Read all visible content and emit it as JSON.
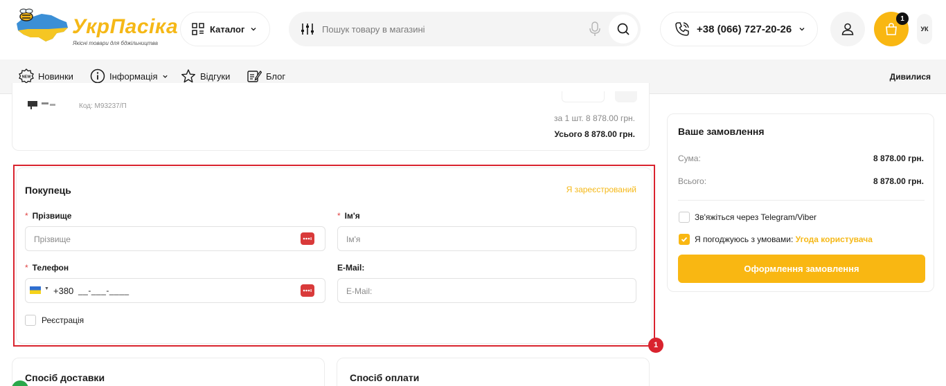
{
  "header": {
    "logo_text": "УкрПасіка",
    "logo_sub": "Якісні товари для бджільництва",
    "catalog_label": "Каталог",
    "search_placeholder": "Пошук товару в магазині",
    "phone": "+38 (066) 727-20-26",
    "cart_count": "1",
    "lang": "УК"
  },
  "nav": {
    "items": [
      {
        "label": "Новинки",
        "icon": "new-badge-icon"
      },
      {
        "label": "Інформація",
        "icon": "info-icon"
      },
      {
        "label": "Відгуки",
        "icon": "star-icon"
      },
      {
        "label": "Блог",
        "icon": "blog-icon"
      }
    ],
    "right_label": "Дивилися"
  },
  "product": {
    "code": "Код: М93237/П",
    "unit_price": "за 1 шт.  8 878.00 грн.",
    "total_price": "Усього  8 878.00 грн."
  },
  "buyer": {
    "title": "Покупець",
    "registered_link": "Я зареєстрований",
    "surname_label": "Прізвище",
    "surname_placeholder": "Прізвище",
    "name_label": "Ім'я",
    "name_placeholder": "Ім'я",
    "phone_label": "Телефон",
    "phone_prefix": "+380",
    "phone_mask": "__-___-____",
    "email_label": "E-Mail:",
    "email_placeholder": "E-Mail:",
    "register_label": "Реєстрація",
    "error_count": "1"
  },
  "sections": {
    "delivery_title": "Спосіб доставки",
    "payment_title": "Спосіб оплати"
  },
  "order": {
    "title": "Ваше замовлення",
    "sum_label": "Сума:",
    "sum_value": "8 878.00 грн.",
    "total_label": "Всього:",
    "total_value": "8 878.00 грн.",
    "telegram_label": "Зв'яжіться через Telegram/Viber",
    "agree_label": "Я погоджуюсь з умовами:",
    "agree_link": "Угода користувача",
    "agree_checked": true,
    "submit_label": "Оформлення замовлення"
  },
  "colors": {
    "accent": "#f9b712",
    "error": "#d9232e"
  }
}
